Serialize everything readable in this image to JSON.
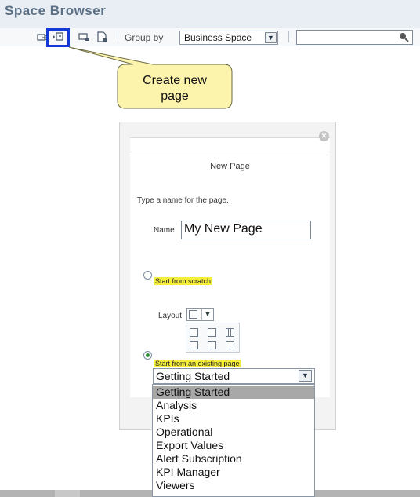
{
  "panel": {
    "title": "Space Browser"
  },
  "toolbar": {
    "group_by_label": "Group by",
    "group_by_value": "Business Space",
    "search_value": ""
  },
  "callout": {
    "line1": "Create new",
    "line2": "page"
  },
  "dialog": {
    "title": "New Page",
    "prompt": "Type a name for the page.",
    "name_label": "Name",
    "name_value": "My New Page",
    "option_scratch": "Start from scratch",
    "layout_label": "Layout",
    "option_existing": "Start from an existing page",
    "existing_selected": "Getting Started",
    "existing_options": [
      "Getting Started",
      "Analysis",
      "KPIs",
      "Operational",
      "Export Values",
      "Alert Subscription",
      "KPI Manager",
      "Viewers"
    ]
  },
  "colors": {
    "highlight": "#f6ef3a",
    "callout_fill": "#fcf3ad",
    "selection_border": "#1238d6"
  }
}
